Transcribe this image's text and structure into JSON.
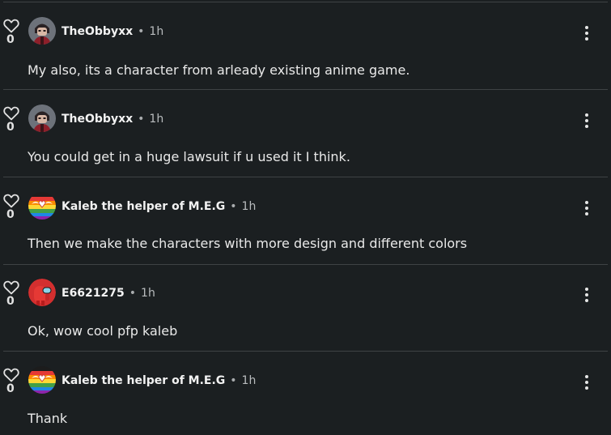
{
  "comments": [
    {
      "username": "TheObbyxx",
      "time": "1h",
      "likes": "0",
      "text": "My also, its a character from arleady existing anime game.",
      "avatar": "dark-roblox-avatar"
    },
    {
      "username": "TheObbyxx",
      "time": "1h",
      "likes": "0",
      "text": "You could get in a huge lawsuit if u used it I think.",
      "avatar": "dark-roblox-avatar"
    },
    {
      "username": "Kaleb the helper of M.E.G",
      "time": "1h",
      "likes": "0",
      "text": "Then we make the characters with more design and different colors",
      "avatar": "rainbow-flag-avatar"
    },
    {
      "username": "E6621275",
      "time": "1h",
      "likes": "0",
      "text": "Ok, wow cool pfp kaleb",
      "avatar": "red-crewmate-avatar"
    },
    {
      "username": "Kaleb the helper of M.E.G",
      "time": "1h",
      "likes": "0",
      "text": "Thank",
      "avatar": "rainbow-flag-avatar"
    }
  ],
  "separator": "•",
  "colors": {
    "background": "#1b1f21",
    "divider": "#3e4245",
    "text": "#e9e9e9"
  },
  "icons": {
    "like": "heart-outline-icon",
    "menu": "vertical-dots-icon"
  }
}
